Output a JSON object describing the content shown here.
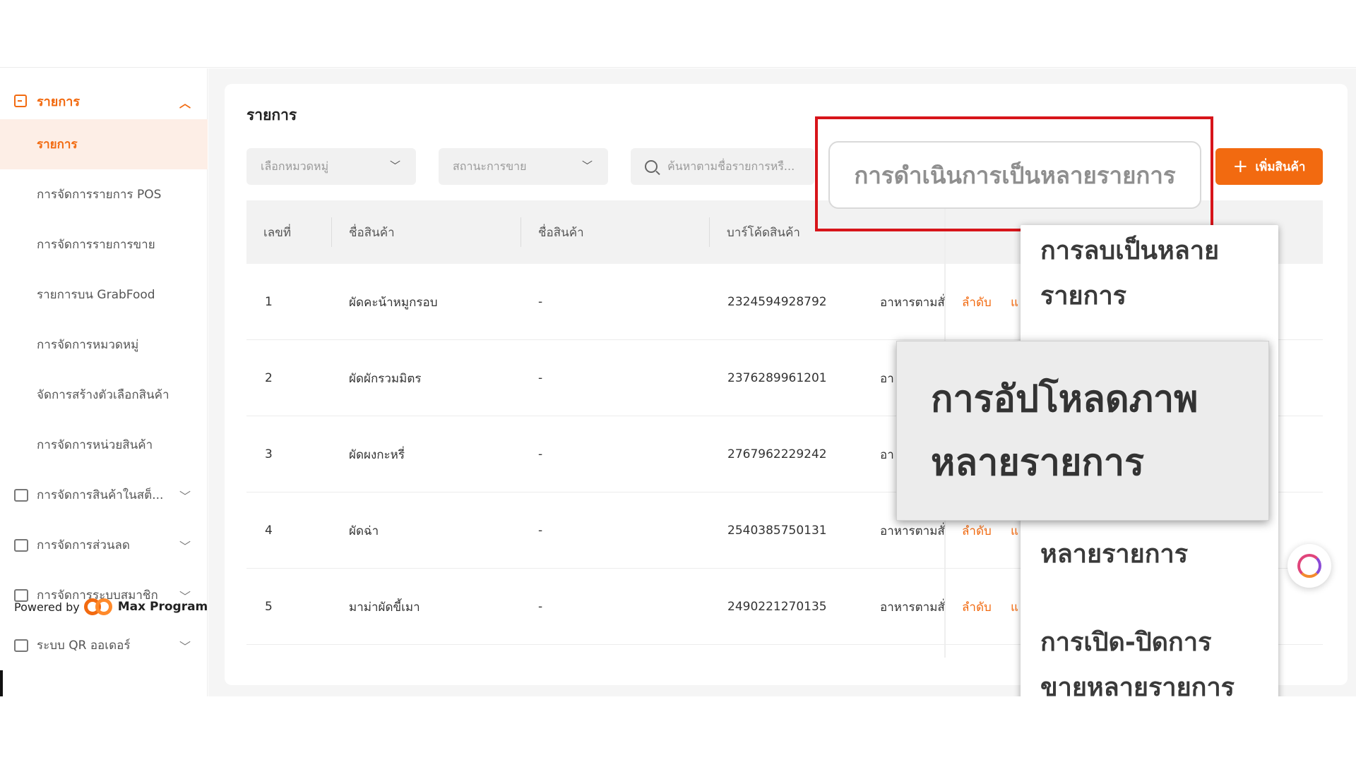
{
  "sidebar": {
    "group_title": "รายการ",
    "items": [
      {
        "label": "รายการ",
        "active": true
      },
      {
        "label": "การจัดการรายการ POS"
      },
      {
        "label": "การจัดการรายการขาย"
      },
      {
        "label": "รายการบน GrabFood"
      },
      {
        "label": "การจัดการหมวดหมู่"
      },
      {
        "label": "จัดการสร้างตัวเลือกสินค้า"
      },
      {
        "label": "การจัดการหน่วยสินค้า"
      }
    ],
    "groups": [
      {
        "label": "การจัดการสินค้าในสต็...",
        "icon": "warehouse-icon"
      },
      {
        "label": "การจัดการส่วนลด",
        "icon": "coupon-icon"
      },
      {
        "label": "การจัดการระบบสมาชิก",
        "icon": "member-icon"
      },
      {
        "label": "ระบบ QR ออเดอร์",
        "icon": "bell-icon"
      }
    ],
    "powered_by": "Powered by",
    "brand": "Max Program"
  },
  "main": {
    "title": "รายการ",
    "filters": {
      "category_placeholder": "เลือกหมวดหมู่",
      "status_placeholder": "สถานะการขาย",
      "search_placeholder": "ค้นหาตามชื่อรายการหรื..."
    },
    "bulk_action_placeholder": "การดำเนินการเป็นหลายรายการ",
    "add_button": "เพิ่มสินค้า",
    "table": {
      "headers": [
        "เลขที่",
        "ชื่อสินค้า",
        "ชื่อสินค้า",
        "บาร์โค้ดสินค้า"
      ],
      "rows": [
        {
          "no": "1",
          "name": "ผัดคะน้าหมูกรอบ",
          "name2": "-",
          "barcode": "2324594928792",
          "category": "อาหารตามสั่",
          "order_link": "ลำดับ",
          "edit_link": "แ"
        },
        {
          "no": "2",
          "name": "ผัดผักรวมมิตร",
          "name2": "-",
          "barcode": "2376289961201",
          "category": "อา",
          "order_link": "",
          "edit_link": ""
        },
        {
          "no": "3",
          "name": "ผัดผงกะหรี่",
          "name2": "-",
          "barcode": "2767962229242",
          "category": "อา",
          "order_link": "",
          "edit_link": ""
        },
        {
          "no": "4",
          "name": "ผัดฉ่า",
          "name2": "-",
          "barcode": "2540385750131",
          "category": "อาหารตามสั่",
          "order_link": "ลำดับ",
          "edit_link": "แ"
        },
        {
          "no": "5",
          "name": "มาม่าผัดขี้เมา",
          "name2": "-",
          "barcode": "2490221270135",
          "category": "อาหารตามสั่",
          "order_link": "ลำดับ",
          "edit_link": "แ"
        }
      ]
    }
  },
  "bulk_menu": {
    "items": [
      "การลบเป็นหลาย",
      "รายการ",
      "หลายรายการ",
      "การเปิด-ปิดการ",
      "ขายหลายรายการ"
    ],
    "hovered": [
      "การอัปโหลดภาพ",
      "หลายรายการ"
    ]
  },
  "colors": {
    "accent": "#f26a10",
    "highlight_frame": "#d7141a"
  }
}
